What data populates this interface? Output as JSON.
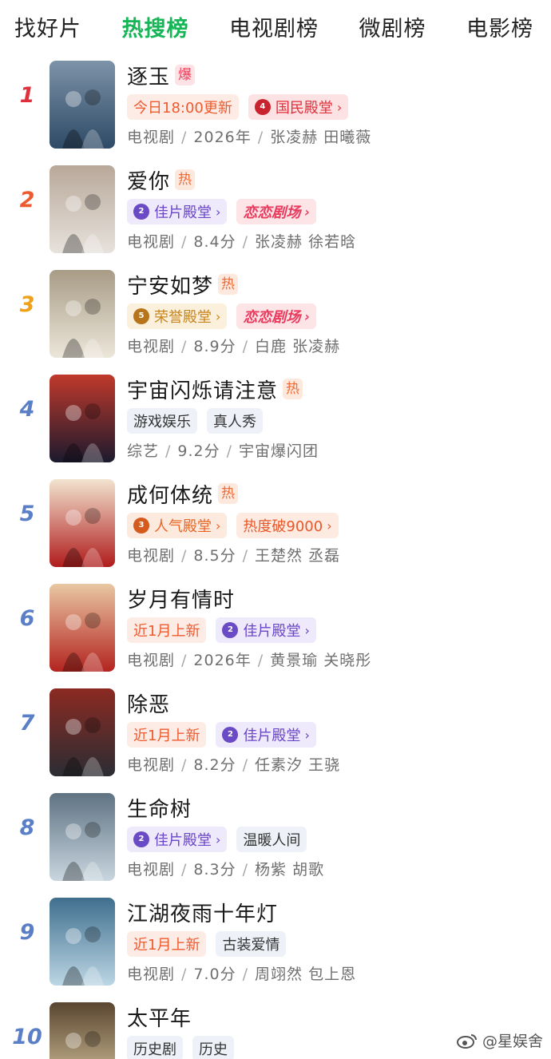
{
  "tabs": [
    {
      "label": "找好片",
      "active": false
    },
    {
      "label": "热搜榜",
      "active": true
    },
    {
      "label": "电视剧榜",
      "active": false
    },
    {
      "label": "微剧榜",
      "active": false
    },
    {
      "label": "电影榜",
      "active": false
    }
  ],
  "colors": {
    "accent": "#16b556",
    "rank1": "#e0303c",
    "rank2": "#ee5a2e",
    "rank3": "#f0a11a",
    "rank_other": "#5b7fc7"
  },
  "items": [
    {
      "rank": "1",
      "title": "逐玉",
      "hot": "爆",
      "tags": [
        {
          "kind": "update",
          "label": "今日18:00更新"
        },
        {
          "kind": "guomin",
          "badge": "4",
          "label": "国民殿堂"
        }
      ],
      "meta": [
        "电视剧",
        "2026年",
        "张凌赫 田曦薇"
      ],
      "poster_colors": [
        "#2e4a66",
        "#7d93a8"
      ]
    },
    {
      "rank": "2",
      "title": "爱你",
      "hot": "热",
      "tags": [
        {
          "kind": "jiapian",
          "badge": "2",
          "label": "佳片殿堂"
        },
        {
          "kind": "lianlian",
          "label": "恋恋剧场"
        }
      ],
      "meta": [
        "电视剧",
        "8.4分",
        "张凌赫 徐若晗"
      ],
      "poster_colors": [
        "#e7e2dc",
        "#b8a89a"
      ]
    },
    {
      "rank": "3",
      "title": "宁安如梦",
      "hot": "热",
      "tags": [
        {
          "kind": "rongyu",
          "badge": "5",
          "label": "荣誉殿堂"
        },
        {
          "kind": "lianlian",
          "label": "恋恋剧场"
        }
      ],
      "meta": [
        "电视剧",
        "8.9分",
        "白鹿 张凌赫"
      ],
      "poster_colors": [
        "#ece6da",
        "#a89c86"
      ]
    },
    {
      "rank": "4",
      "title": "宇宙闪烁请注意",
      "hot": "热",
      "tags": [
        {
          "kind": "genre",
          "label": "游戏娱乐"
        },
        {
          "kind": "genre",
          "label": "真人秀"
        }
      ],
      "meta": [
        "综艺",
        "9.2分",
        "宇宙爆闪团"
      ],
      "poster_colors": [
        "#1c1a2e",
        "#c0392b"
      ]
    },
    {
      "rank": "5",
      "title": "成何体统",
      "hot": "热",
      "tags": [
        {
          "kind": "renqi",
          "badge": "3",
          "label": "人气殿堂"
        },
        {
          "kind": "heat",
          "label": "热度破9000"
        }
      ],
      "meta": [
        "电视剧",
        "8.5分",
        "王楚然 丞磊"
      ],
      "poster_colors": [
        "#b01c1c",
        "#f2e4d0"
      ]
    },
    {
      "rank": "6",
      "title": "岁月有情时",
      "hot": "",
      "tags": [
        {
          "kind": "update",
          "label": "近1月上新"
        },
        {
          "kind": "jiapian",
          "badge": "2",
          "label": "佳片殿堂"
        }
      ],
      "meta": [
        "电视剧",
        "2026年",
        "黄景瑜 关晓彤"
      ],
      "poster_colors": [
        "#b3241f",
        "#e9c7a3"
      ]
    },
    {
      "rank": "7",
      "title": "除恶",
      "hot": "",
      "tags": [
        {
          "kind": "update",
          "label": "近1月上新"
        },
        {
          "kind": "jiapian",
          "badge": "2",
          "label": "佳片殿堂"
        }
      ],
      "meta": [
        "电视剧",
        "8.2分",
        "任素汐 王骁"
      ],
      "poster_colors": [
        "#2a2d33",
        "#8c2a22"
      ]
    },
    {
      "rank": "8",
      "title": "生命树",
      "hot": "",
      "tags": [
        {
          "kind": "jiapian",
          "badge": "2",
          "label": "佳片殿堂"
        },
        {
          "kind": "genre",
          "label": "温暖人间"
        }
      ],
      "meta": [
        "电视剧",
        "8.3分",
        "杨紫 胡歌"
      ],
      "poster_colors": [
        "#c9d6df",
        "#5f7383"
      ]
    },
    {
      "rank": "9",
      "title": "江湖夜雨十年灯",
      "hot": "",
      "tags": [
        {
          "kind": "update",
          "label": "近1月上新"
        },
        {
          "kind": "genre",
          "label": "古装爱情"
        }
      ],
      "meta": [
        "电视剧",
        "7.0分",
        "周翊然 包上恩"
      ],
      "poster_colors": [
        "#bcd6e4",
        "#3f6f8e"
      ]
    },
    {
      "rank": "10",
      "title": "太平年",
      "hot": "",
      "tags": [
        {
          "kind": "genre",
          "label": "历史剧"
        },
        {
          "kind": "genre",
          "label": "历史"
        }
      ],
      "meta": [],
      "poster_colors": [
        "#d8c7a0",
        "#5a4630"
      ]
    }
  ],
  "watermark": "@星娱舍"
}
